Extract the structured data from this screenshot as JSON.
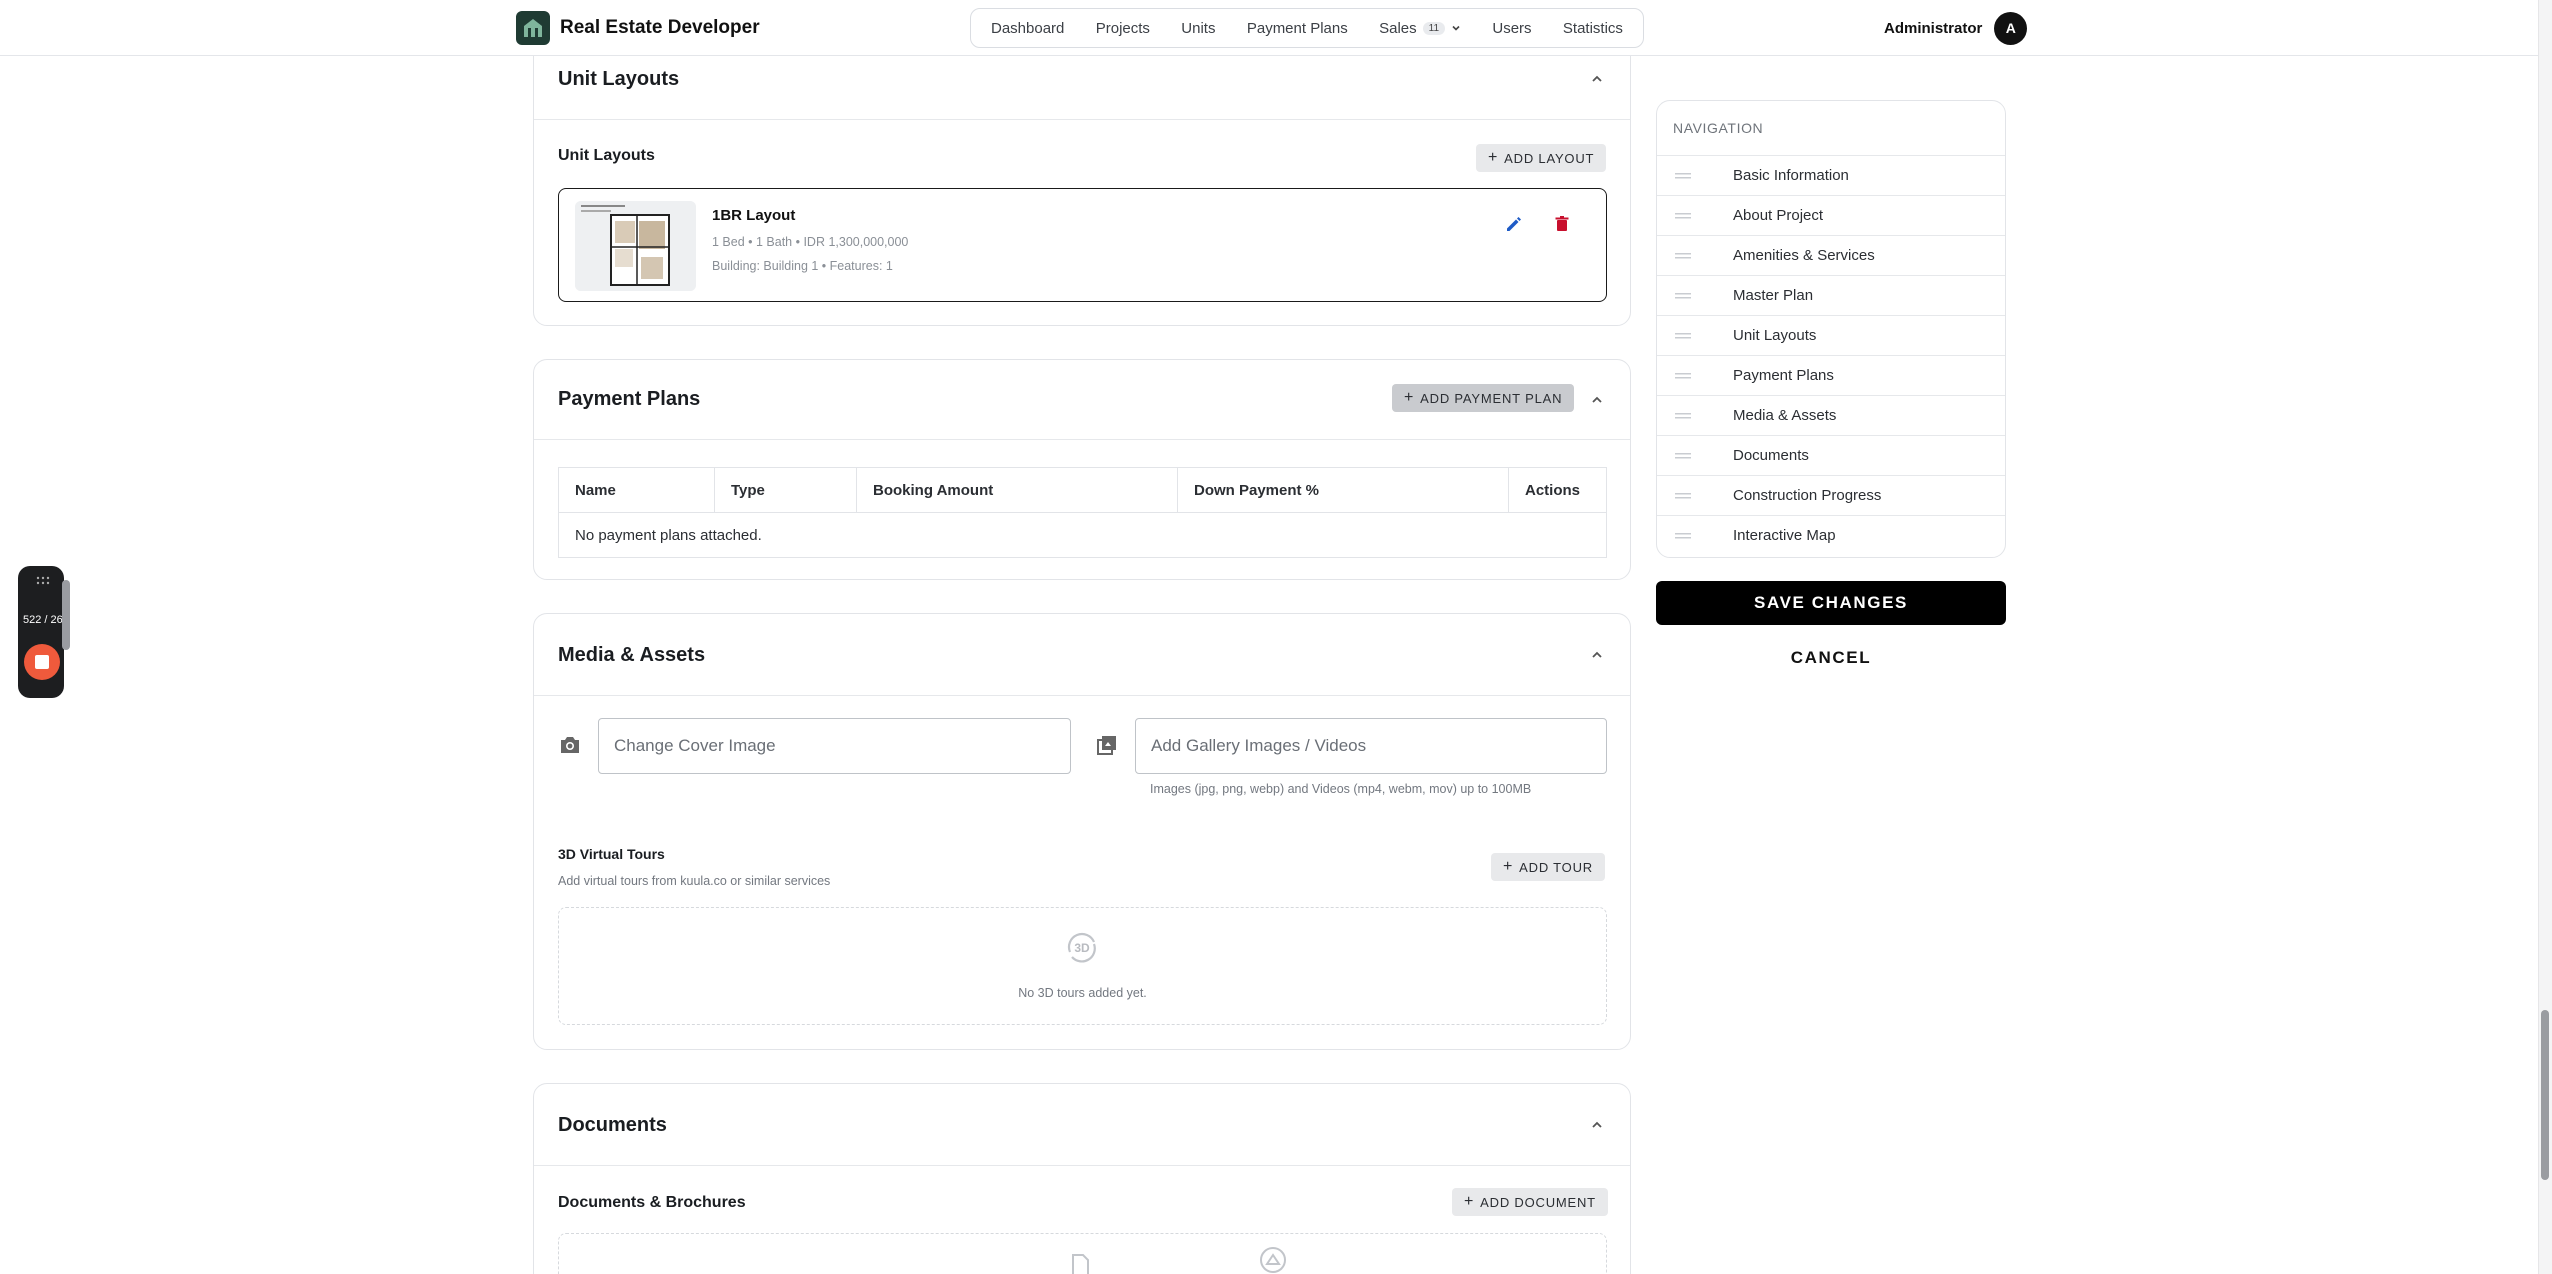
{
  "header": {
    "brand": "Real Estate Developer",
    "nav": [
      {
        "label": "Dashboard"
      },
      {
        "label": "Projects"
      },
      {
        "label": "Units"
      },
      {
        "label": "Payment Plans"
      },
      {
        "label": "Sales",
        "badge": "11"
      },
      {
        "label": "Users"
      },
      {
        "label": "Statistics"
      }
    ],
    "user_name": "Administrator",
    "avatar_initial": "A"
  },
  "unit_layouts": {
    "title": "Unit Layouts",
    "section_label": "Unit Layouts",
    "add_button": "ADD LAYOUT",
    "items": [
      {
        "name": "1BR Layout",
        "specs": "1 Bed • 1 Bath • IDR 1,300,000,000",
        "details": "Building: Building 1 • Features: 1"
      }
    ]
  },
  "payment_plans": {
    "title": "Payment Plans",
    "add_button": "ADD PAYMENT PLAN",
    "columns": [
      "Name",
      "Type",
      "Booking Amount",
      "Down Payment %",
      "Actions"
    ],
    "empty_text": "No payment plans attached."
  },
  "media_assets": {
    "title": "Media & Assets",
    "cover_placeholder": "Change Cover Image",
    "gallery_placeholder": "Add Gallery Images / Videos",
    "gallery_hint": "Images (jpg, png, webp) and Videos (mp4, webm, mov) up to 100MB",
    "tours_title": "3D Virtual Tours",
    "tours_subtitle": "Add virtual tours from kuula.co or similar services",
    "add_tour_button": "ADD TOUR",
    "tours_badge": "3D",
    "tours_empty": "No 3D tours added yet."
  },
  "documents": {
    "title": "Documents",
    "section_label": "Documents & Brochures",
    "add_button": "ADD DOCUMENT"
  },
  "sidebar": {
    "title": "NAVIGATION",
    "items": [
      "Basic Information",
      "About Project",
      "Amenities & Services",
      "Master Plan",
      "Unit Layouts",
      "Payment Plans",
      "Media & Assets",
      "Documents",
      "Construction Progress",
      "Interactive Map"
    ],
    "save_button": "SAVE CHANGES",
    "cancel_button": "CANCEL"
  },
  "recorder": {
    "counter": "522 / 26"
  },
  "colors": {
    "accent_dark": "#000000",
    "edit_icon": "#1e5bc6",
    "delete_icon": "#c8102e",
    "brand_logo_bg": "#1f3b33"
  }
}
